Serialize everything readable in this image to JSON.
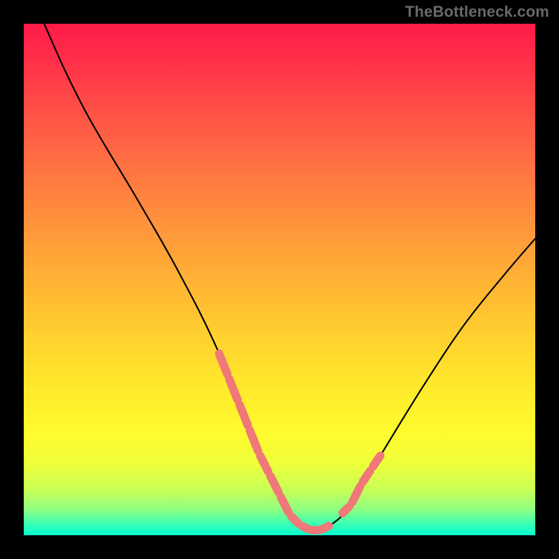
{
  "attribution": "TheBottleneck.com",
  "chart_data": {
    "type": "line",
    "title": "",
    "xlabel": "",
    "ylabel": "",
    "xlim": [
      0,
      100
    ],
    "ylim": [
      0,
      100
    ],
    "series": [
      {
        "name": "bottleneck-curve",
        "x": [
          4,
          8,
          12,
          16,
          22,
          30,
          38,
          46,
          51,
          54,
          57,
          60,
          64,
          70,
          78,
          86,
          94,
          100
        ],
        "y": [
          100,
          91,
          83,
          76,
          66,
          52,
          36,
          16,
          6,
          2,
          1,
          2,
          6,
          16,
          29,
          41,
          51,
          58
        ]
      }
    ],
    "highlight_segments": [
      {
        "name": "left-shoulder",
        "x": [
          38,
          40,
          42,
          44,
          46,
          48,
          50,
          52,
          54
        ],
        "y": [
          36,
          31,
          26,
          21,
          16,
          12,
          8,
          4,
          2
        ]
      },
      {
        "name": "valley",
        "x": [
          54,
          56,
          58,
          60
        ],
        "y": [
          2,
          1,
          1,
          2
        ]
      },
      {
        "name": "right-shoulder",
        "x": [
          62,
          64,
          66,
          68,
          70
        ],
        "y": [
          4,
          6,
          10,
          13,
          16
        ]
      }
    ],
    "colors": {
      "curve": "#000000",
      "highlight": "#f07878"
    }
  }
}
